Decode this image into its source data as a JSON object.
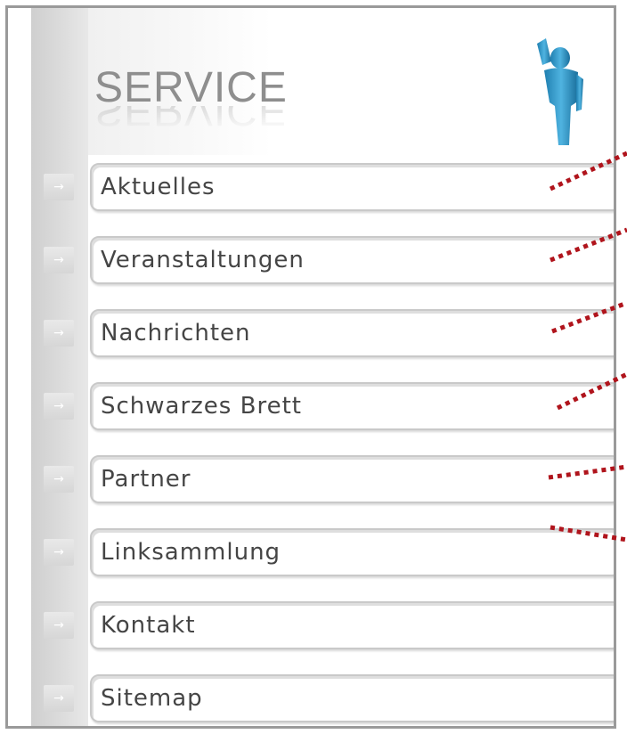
{
  "header": {
    "title": "SERVICE",
    "icon": "person-icon"
  },
  "menu": {
    "items": [
      {
        "label": "Aktuelles"
      },
      {
        "label": "Veranstaltungen"
      },
      {
        "label": "Nachrichten"
      },
      {
        "label": "Schwarzes Brett"
      },
      {
        "label": "Partner"
      },
      {
        "label": "Linksammlung"
      },
      {
        "label": "Kontakt"
      },
      {
        "label": "Sitemap"
      }
    ],
    "arrow_glyph": "→"
  },
  "colors": {
    "title_gray": "#8e8e8e",
    "menu_text": "#454545",
    "pill_border": "#c9c9c9",
    "annotation_red": "#b0141c",
    "icon_blue": "#2f97c9"
  }
}
